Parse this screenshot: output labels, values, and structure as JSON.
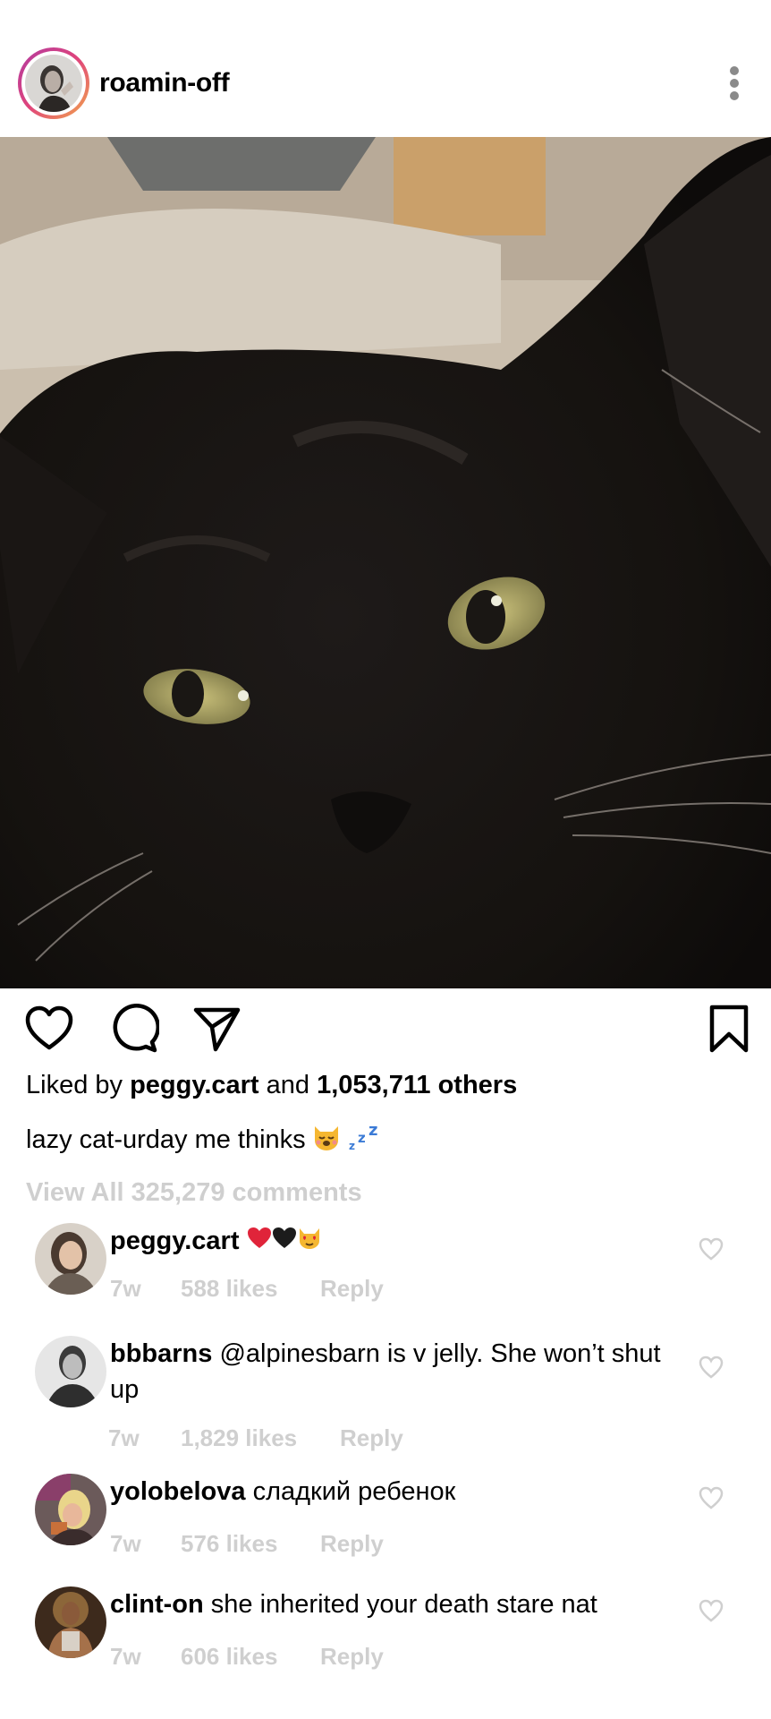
{
  "post": {
    "username": "roamin-off",
    "likes": {
      "prefix": "Liked by",
      "liker": "peggy.cart",
      "joiner": "and",
      "others": "1,053,711 others"
    },
    "caption": "lazy cat-urday me thinks",
    "view_all": "View All 325,279 comments"
  },
  "comments": [
    {
      "user": "peggy.cart",
      "text": "",
      "time": "7w",
      "likes": "588 likes",
      "reply": "Reply"
    },
    {
      "user": "bbbarns",
      "text": "@alpinesbarn is v jelly. She won’t shut up",
      "time": "7w",
      "likes": "1,829 likes",
      "reply": "Reply"
    },
    {
      "user": "yolobelova",
      "text": "сладкий ребенок",
      "time": "7w",
      "likes": "576 likes",
      "reply": "Reply"
    },
    {
      "user": "clint-on",
      "text": "she inherited your death stare nat",
      "time": "7w",
      "likes": "606 likes",
      "reply": "Reply"
    }
  ],
  "icons": {
    "more": "more-vertical-icon",
    "like": "heart-icon",
    "comment": "comment-icon",
    "share": "send-icon",
    "save": "bookmark-icon"
  },
  "colors": {
    "text": "#000000",
    "muted": "#cfcfcf",
    "story_ring_start": "#b13aa0",
    "story_ring_end": "#f2a94a"
  }
}
